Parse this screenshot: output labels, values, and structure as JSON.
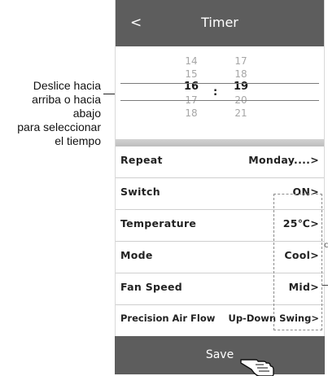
{
  "header": {
    "back_label": "<",
    "title": "Timer"
  },
  "picker": {
    "hours": [
      "14",
      "15",
      "16",
      "17",
      "18"
    ],
    "minutes": [
      "17",
      "18",
      "19",
      "20",
      "21"
    ],
    "separator": ":",
    "selected_hour": "16",
    "selected_minute": "19"
  },
  "settings": [
    {
      "label": "Repeat",
      "value": "Monday....>"
    },
    {
      "label": "Switch",
      "value": "ON>"
    },
    {
      "label": "Temperature",
      "value": "25℃>"
    },
    {
      "label": "Mode",
      "value": "Cool>"
    },
    {
      "label": "Fan Speed",
      "value": "Mid>"
    },
    {
      "label": "Precision Air Flow",
      "value": "Up-Down Swing>"
    }
  ],
  "footer": {
    "save_label": "Save"
  },
  "annotation": {
    "line1": "Deslice hacia",
    "line2": "arriba o hacia",
    "line3": "abajo",
    "line4": "para seleccionar",
    "line5": "el tiempo"
  },
  "colors": {
    "bar": "#5d5d5d",
    "background": "#ffffff",
    "divider": "#cfcfcf"
  },
  "icons": {
    "pointer": "hand-pointer-icon"
  }
}
